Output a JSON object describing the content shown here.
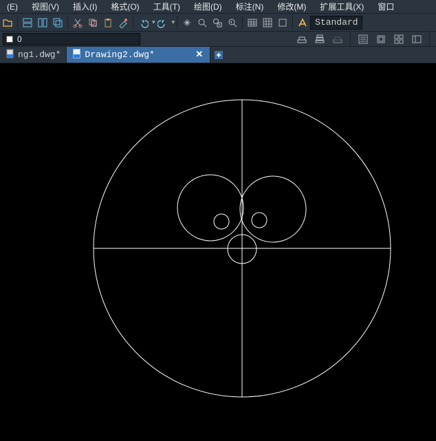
{
  "menu": {
    "items": [
      "(E)",
      "视图(V)",
      "插入(I)",
      "格式(O)",
      "工具(T)",
      "绘图(D)",
      "标注(N)",
      "修改(M)",
      "扩展工具(X)",
      "窗口"
    ]
  },
  "toolbar": {
    "style_current": "Standard"
  },
  "layer": {
    "current": "0"
  },
  "tabs": {
    "items": [
      {
        "label": "ng1.dwg*"
      },
      {
        "label": "Drawing2.dwg*"
      }
    ],
    "active_index": 1
  }
}
